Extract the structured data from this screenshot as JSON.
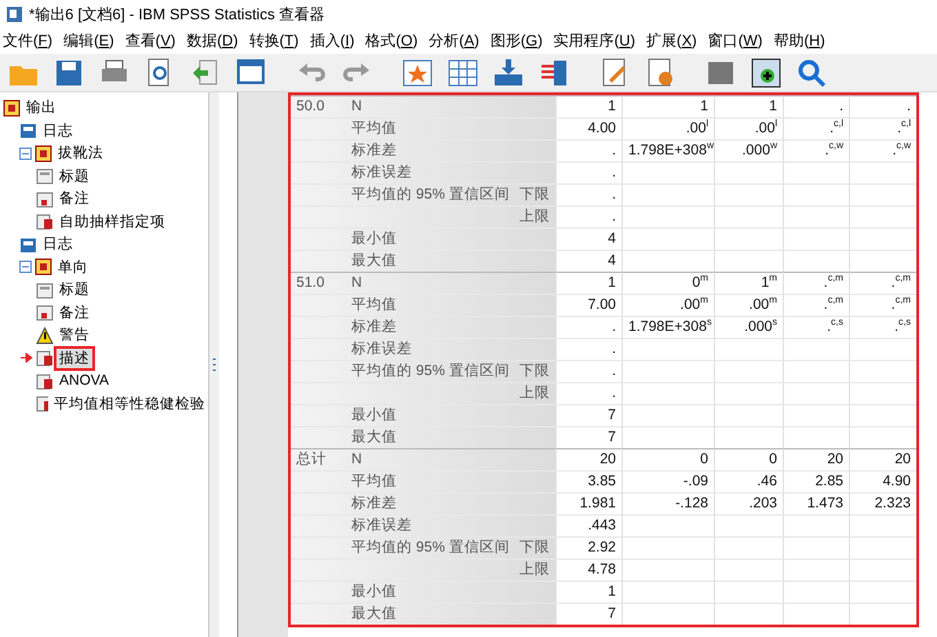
{
  "window": {
    "title": "*输出6 [文档6] - IBM SPSS Statistics 查看器"
  },
  "menu": [
    "文件(F)",
    "编辑(E)",
    "查看(V)",
    "数据(D)",
    "转换(T)",
    "插入(I)",
    "格式(O)",
    "分析(A)",
    "图形(G)",
    "实用程序(U)",
    "扩展(X)",
    "窗口(W)",
    "帮助(H)"
  ],
  "outline": [
    {
      "label": "输出",
      "kind": "book",
      "selected": false,
      "children": [
        {
          "label": "日志",
          "kind": "log",
          "selected": false
        },
        {
          "label": "拔靴法",
          "kind": "book",
          "selected": false,
          "expanded": true,
          "children": [
            {
              "label": "标题",
              "kind": "title",
              "selected": false
            },
            {
              "label": "备注",
              "kind": "note",
              "selected": false
            },
            {
              "label": "自助抽样指定项",
              "kind": "table",
              "selected": false
            }
          ]
        },
        {
          "label": "日志",
          "kind": "log",
          "selected": false
        },
        {
          "label": "单向",
          "kind": "book",
          "selected": false,
          "expanded": true,
          "children": [
            {
              "label": "标题",
              "kind": "title",
              "selected": false
            },
            {
              "label": "备注",
              "kind": "note",
              "selected": false
            },
            {
              "label": "警告",
              "kind": "warning",
              "selected": false
            },
            {
              "label": "描述",
              "kind": "table",
              "selected": true
            },
            {
              "label": "ANOVA",
              "kind": "table",
              "selected": false
            },
            {
              "label": "平均值相等性稳健检验",
              "kind": "table",
              "selected": false
            }
          ]
        }
      ]
    }
  ],
  "table": {
    "groups": [
      {
        "label": "50.0",
        "rows": [
          {
            "stat": "N",
            "values": [
              "1",
              "1",
              "1",
              ".",
              "."
            ]
          },
          {
            "stat": "平均值",
            "values": [
              "4.00",
              ".00$^{l}$",
              ".00$^{l}$",
              ".$^{c,l}$",
              ".$^{c,l}$"
            ]
          },
          {
            "stat": "标准差",
            "values": [
              ".",
              "1.798E+308$^{w}$",
              ".000$^{w}$",
              ".$^{c,w}$",
              ".$^{c,w}$"
            ]
          },
          {
            "stat": "标准误差",
            "values": [
              "."
            ]
          },
          {
            "stat": "平均值的 95% 置信区间",
            "bound": "下限",
            "values": [
              "."
            ]
          },
          {
            "bound": "上限",
            "values": [
              "."
            ]
          },
          {
            "stat": "最小值",
            "values": [
              "4"
            ]
          },
          {
            "stat": "最大值",
            "values": [
              "4"
            ]
          }
        ]
      },
      {
        "label": "51.0",
        "rows": [
          {
            "stat": "N",
            "values": [
              "1",
              "0$^{m}$",
              "1$^{m}$",
              ".$^{c,m}$",
              ".$^{c,m}$"
            ]
          },
          {
            "stat": "平均值",
            "values": [
              "7.00",
              ".00$^{m}$",
              ".00$^{m}$",
              ".$^{c,m}$",
              ".$^{c,m}$"
            ]
          },
          {
            "stat": "标准差",
            "values": [
              ".",
              "1.798E+308$^{s}$",
              ".000$^{s}$",
              ".$^{c,s}$",
              ".$^{c,s}$"
            ]
          },
          {
            "stat": "标准误差",
            "values": [
              "."
            ]
          },
          {
            "stat": "平均值的 95% 置信区间",
            "bound": "下限",
            "values": [
              "."
            ]
          },
          {
            "bound": "上限",
            "values": [
              "."
            ]
          },
          {
            "stat": "最小值",
            "values": [
              "7"
            ]
          },
          {
            "stat": "最大值",
            "values": [
              "7"
            ]
          }
        ]
      },
      {
        "label": "总计",
        "rows": [
          {
            "stat": "N",
            "values": [
              "20",
              "0",
              "0",
              "20",
              "20"
            ]
          },
          {
            "stat": "平均值",
            "values": [
              "3.85",
              "-.09",
              ".46",
              "2.85",
              "4.90"
            ]
          },
          {
            "stat": "标准差",
            "values": [
              "1.981",
              "-.128",
              ".203",
              "1.473",
              "2.323"
            ]
          },
          {
            "stat": "标准误差",
            "values": [
              ".443"
            ]
          },
          {
            "stat": "平均值的 95% 置信区间",
            "bound": "下限",
            "values": [
              "2.92"
            ]
          },
          {
            "bound": "上限",
            "values": [
              "4.78"
            ]
          },
          {
            "stat": "最小值",
            "values": [
              "1"
            ]
          },
          {
            "stat": "最大值",
            "values": [
              "7"
            ]
          }
        ]
      }
    ]
  }
}
